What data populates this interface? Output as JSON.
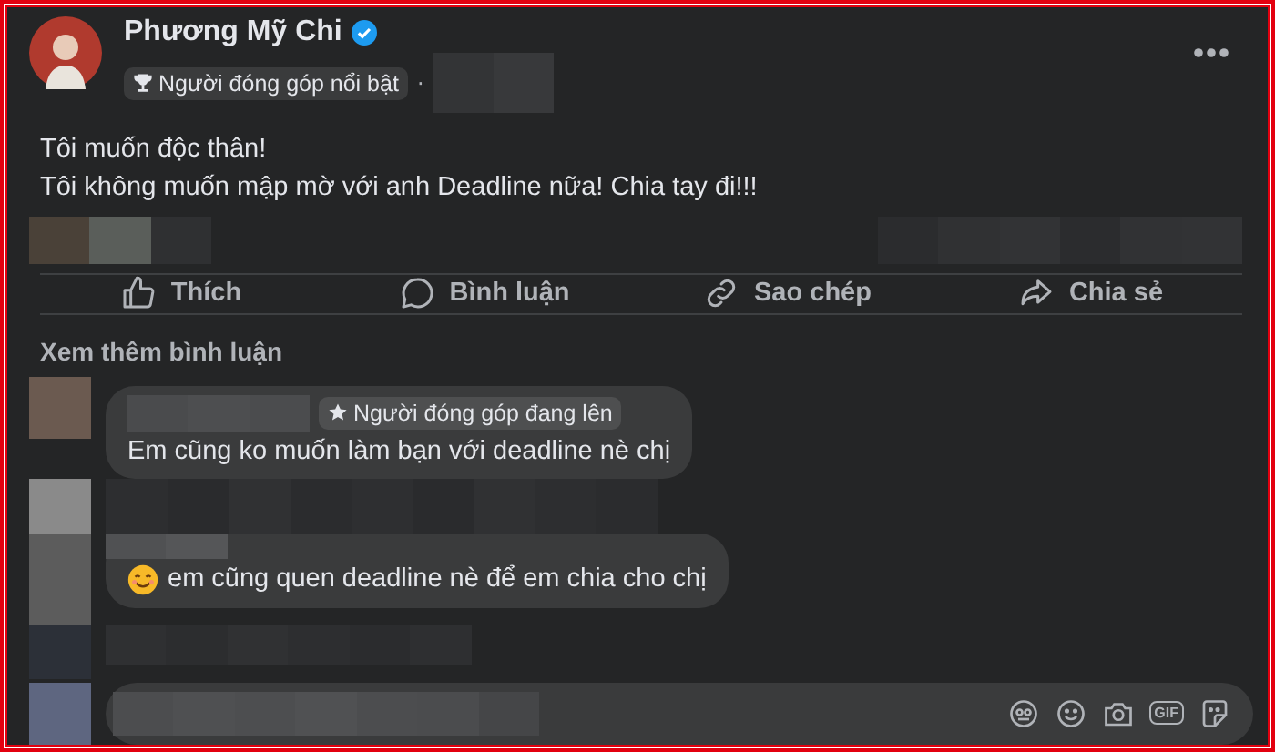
{
  "post": {
    "author": "Phương Mỹ Chi",
    "verified": true,
    "badge": "Người đóng góp nổi bật",
    "separator": "·",
    "lines": [
      "Tôi muốn độc thân!",
      "Tôi không muốn mập mờ với anh Deadline nữa! Chia tay đi!!!"
    ]
  },
  "actions": [
    {
      "kind": "like",
      "label": "Thích"
    },
    {
      "kind": "comment",
      "label": "Bình luận"
    },
    {
      "kind": "copy",
      "label": "Sao chép"
    },
    {
      "kind": "share",
      "label": "Chia sẻ"
    }
  ],
  "more_comments": "Xem thêm bình luận",
  "comments": [
    {
      "badge": "Người đóng góp đang lên",
      "text": "Em cũng ko muốn làm bạn với deadline nè chị",
      "emoji": false
    },
    {
      "text": "em cũng quen deadline nè để em chia cho chị",
      "emoji": true
    }
  ],
  "composer": {
    "icons": [
      {
        "kind": "avatar"
      },
      {
        "kind": "emoji"
      },
      {
        "kind": "camera"
      },
      {
        "kind": "gif",
        "label": "GIF"
      },
      {
        "kind": "sticker"
      }
    ]
  }
}
